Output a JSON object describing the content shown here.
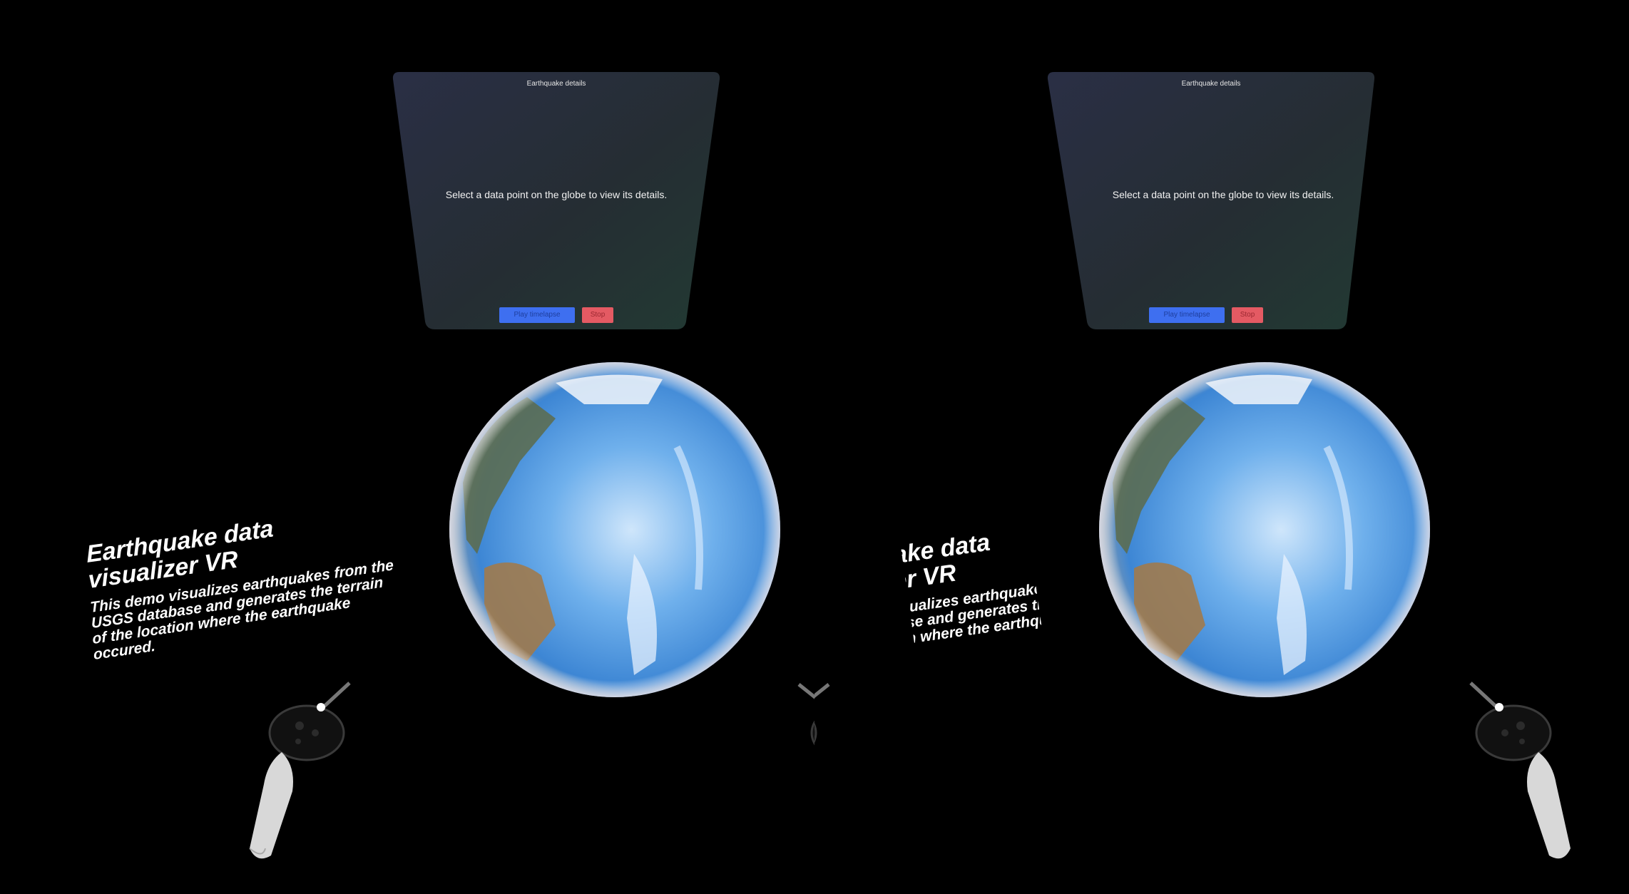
{
  "app": {
    "intro_title": "Earthquake data\nvisualizer VR",
    "intro_description": "This demo visualizes earthquakes from the USGS database and generates the terrain of the location where the earthquake occured."
  },
  "details_panel": {
    "title": "Earthquake details",
    "message": "Select a data point on the globe to view its details.",
    "play_button": "Play timelapse",
    "stop_button": "Stop"
  },
  "colors": {
    "background": "#000000",
    "panel_gradient_start": "#2a2f45",
    "panel_gradient_end": "#223a33",
    "play_button": "#3e6ff0",
    "stop_button": "#e45a63",
    "ocean": "#4f97e0"
  },
  "icons": {
    "globe": "earth-globe-icon",
    "controller": "vr-controller-icon"
  }
}
